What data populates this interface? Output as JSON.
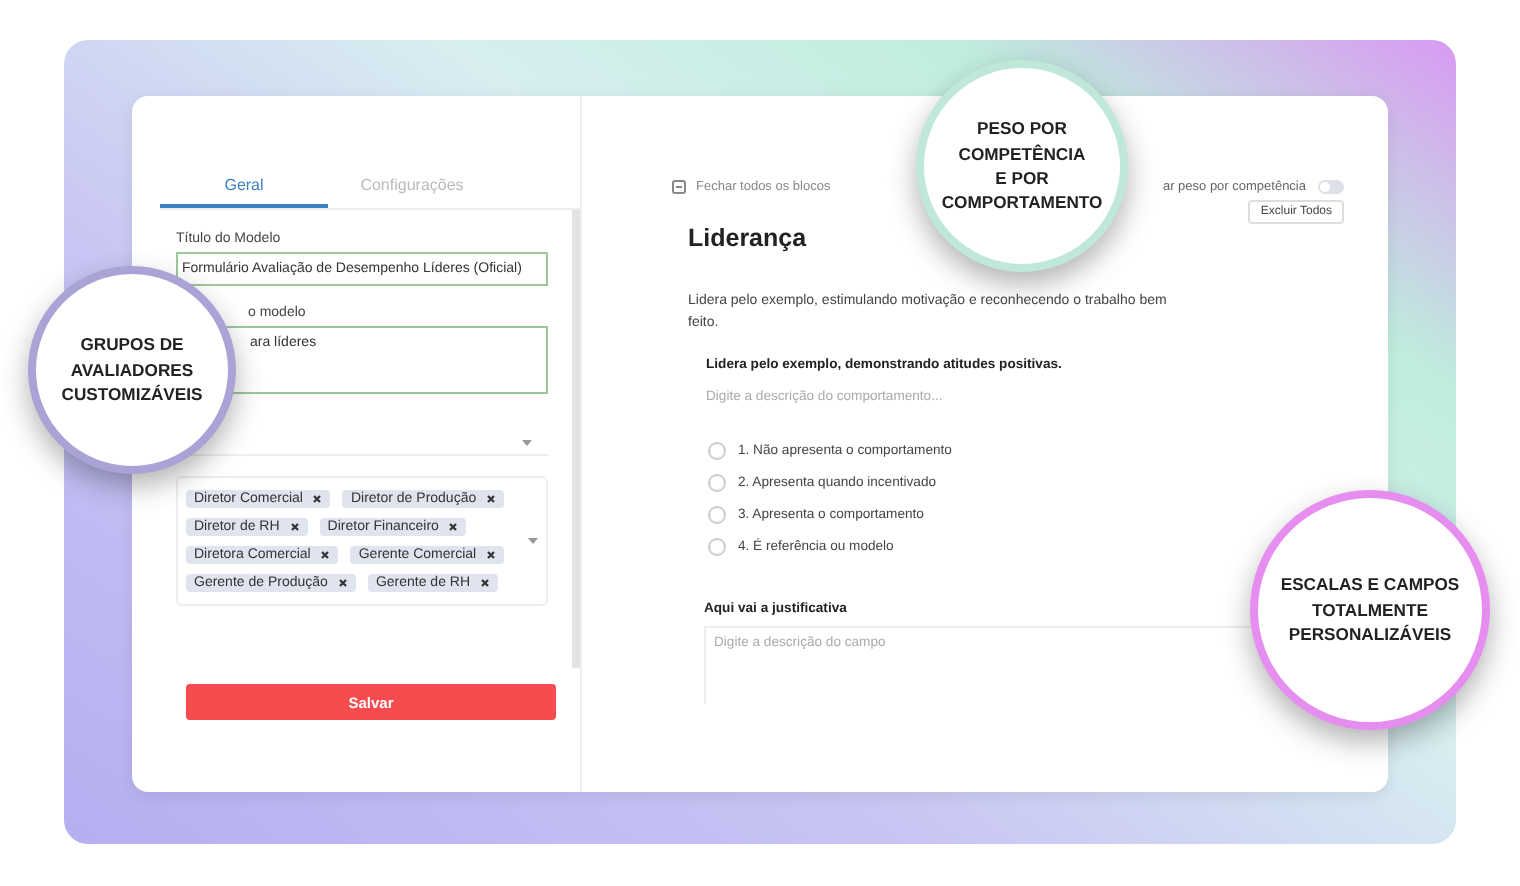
{
  "tabs": [
    {
      "label": "Geral",
      "selected": true
    },
    {
      "label": "Configurações",
      "selected": false
    }
  ],
  "form": {
    "title_label": "Título do Modelo",
    "title_value": "Formulário Avaliação de Desempenho Líderes (Oficial)",
    "description_label": "o modelo",
    "description_value": "ara líderes",
    "groups": [
      "Diretor Comercial",
      "Diretor de Produção",
      "Diretor de RH",
      "Diretor Financeiro",
      "Diretora Comercial",
      "Gerente Comercial",
      "Gerente de Produção",
      "Gerente de RH"
    ],
    "save_button": "Salvar"
  },
  "editor": {
    "collapse_all": "Fechar todos os blocos",
    "weight_toggle": {
      "label": "ar peso por competência",
      "on": false
    },
    "delete_all": "Excluir Todos",
    "block_title": "Liderança",
    "block_description": "Lidera pelo exemplo, estimulando motivação e reconhecendo o trabalho bem feito.",
    "behavior": {
      "title": "Lidera pelo exemplo, demonstrando atitudes positivas.",
      "placeholder": "Digite a descrição do comportamento..."
    },
    "scale": [
      {
        "label": "1. Não apresenta o comportamento",
        "selected": false
      },
      {
        "label": "2. Apresenta quando incentivado",
        "selected": false
      },
      {
        "label": "3. Apresenta o comportamento",
        "selected": false
      },
      {
        "label": "4. É referência ou modelo",
        "selected": false
      }
    ],
    "justification": {
      "label": "Aqui vai a justificativa",
      "placeholder": "Digite a descrição do campo"
    }
  },
  "callouts": [
    {
      "text": "GRUPOS DE\nAVALIADORES\nCUSTOMIZÁVEIS",
      "color": "#a9a3d6"
    },
    {
      "text": "PESO POR\nCOMPETÊNCIA\nE POR\nCOMPORTAMENTO",
      "color": "#bfe8d8"
    },
    {
      "text": "ESCALAS E CAMPOS\nTOTALMENTE\nPERSONALIZÁVEIS",
      "color": "#e58ef0"
    }
  ]
}
